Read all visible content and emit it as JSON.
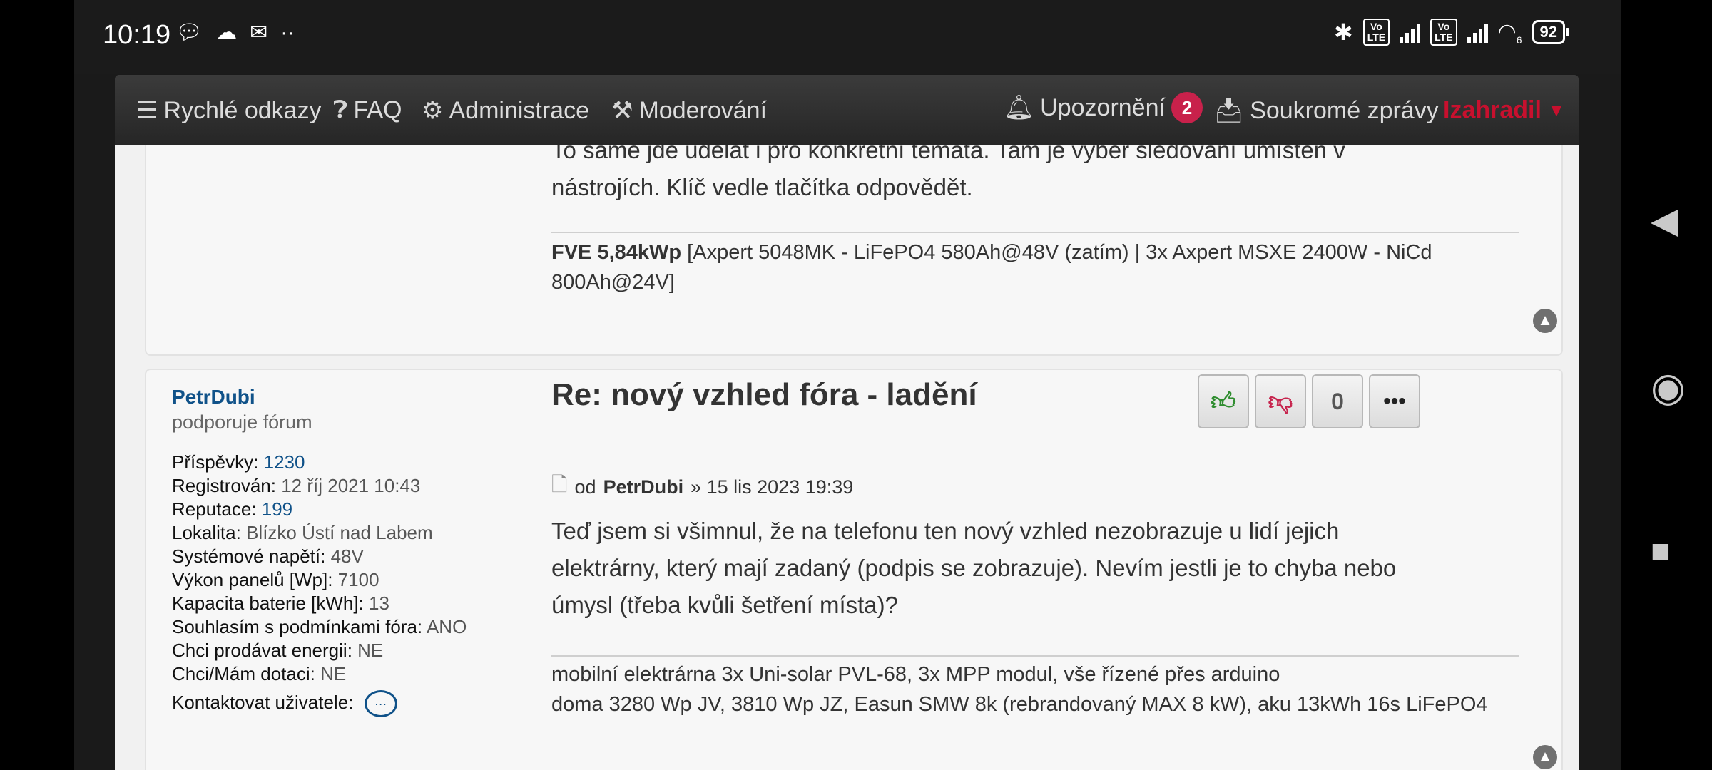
{
  "status_bar": {
    "time": "10:19",
    "battery": "92",
    "left_icons": [
      "chat-bubble-icon",
      "cloud-icon",
      "image-message-icon",
      "dots-icon"
    ],
    "right_icons": [
      "bluetooth-icon",
      "volte-icon",
      "signal-icon",
      "volte-icon",
      "signal-icon",
      "wifi-icon",
      "battery-icon"
    ],
    "volte_label": "Vo\nLTE",
    "wifi_label": "6"
  },
  "nav": {
    "quick_links": "Rychlé odkazy",
    "faq": "FAQ",
    "admin": "Administrace",
    "moderation": "Moderování",
    "notifications": "Upozornění",
    "notifications_count": "2",
    "private_messages": "Soukromé zprávy",
    "username": "Izahradil"
  },
  "post1": {
    "body": "To samé jde udělat i pro konkrétní témata. Tam je výběr sledování umístěn v nástrojích. Klíč vedle tlačítka odpovědět.",
    "sig_bold": "FVE 5,84kWp",
    "sig_rest": " [Axpert 5048MK - LiFePO4 580Ah@48V (zatím) | 3x Axpert MSXE 2400W - NiCd 800Ah@24V]"
  },
  "post2": {
    "author": "PetrDubi",
    "rank": "podporuje fórum",
    "profile": [
      {
        "label": "Příspěvky:",
        "value": "1230",
        "link": true
      },
      {
        "label": "Registrován:",
        "value": "12 říj 2021 10:43",
        "link": false
      },
      {
        "label": "Reputace:",
        "value": "199",
        "link": true
      },
      {
        "label": "Lokalita:",
        "value": "Blízko Ústí nad Labem",
        "link": false
      },
      {
        "label": "Systémové napětí:",
        "value": "48V",
        "link": false
      },
      {
        "label": "Výkon panelů [Wp]:",
        "value": "7100",
        "link": false
      },
      {
        "label": "Kapacita baterie [kWh]:",
        "value": "13",
        "link": false
      },
      {
        "label": "Souhlasím s podmínkami fóra:",
        "value": "ANO",
        "link": false
      },
      {
        "label": "Chci prodávat energii:",
        "value": "NE",
        "link": false
      },
      {
        "label": "Chci/Mám dotaci:",
        "value": "NE",
        "link": false
      }
    ],
    "contact_label": "Kontaktovat uživatele:",
    "title": "Re: nový vzhled fóra - ladění",
    "votes": "0",
    "meta_prefix": "od",
    "meta_author": "PetrDubi",
    "meta_date": "» 15 lis 2023 19:39",
    "body": "Teď jsem si všimnul, že na telefonu ten nový vzhled nezobrazuje u lidí jejich elektrárny, který mají zadaný (podpis se zobrazuje). Nevím jestli je to chyba nebo úmysl (třeba kvůli šetření místa)?",
    "sig_line1": "mobilní elektrárna 3x Uni-solar PVL-68, 3x MPP modul, vše řízené přes arduino",
    "sig_line2": "doma 3280 Wp JV, 3810 Wp JZ, Easun SMW 8k (rebrandovaný MAX 8 kW), aku 13kWh 16s LiFePO4"
  }
}
